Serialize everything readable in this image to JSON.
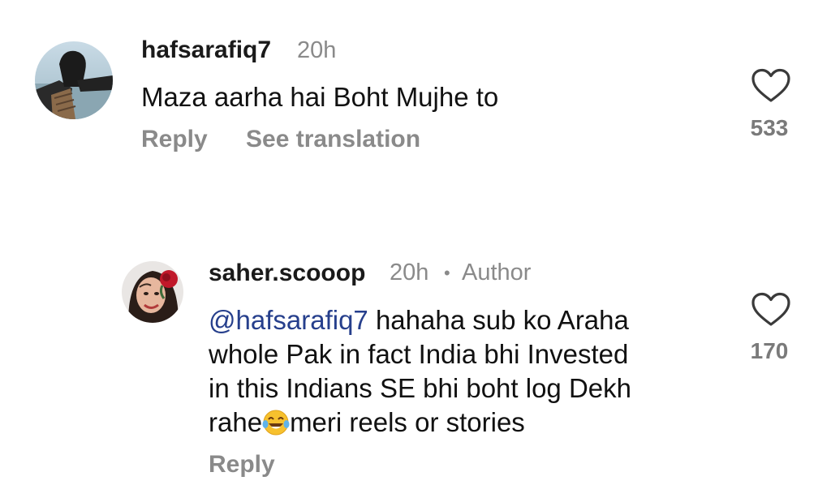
{
  "comments": [
    {
      "username": "hafsarafiq7",
      "time": "20h",
      "text": "Maza aarha hai Boht Mujhe to",
      "actions": {
        "reply": "Reply",
        "translate": "See translation"
      },
      "likes": "533",
      "avatar_icon": "profile-photo"
    },
    {
      "username": "saher.scooop",
      "time": "20h",
      "separator": "•",
      "badge": "Author",
      "mention": "@hafsarafiq7",
      "text_line1": " hahaha sub ko Araha",
      "text_line2": "whole Pak in fact India bhi Invested",
      "text_line3": "in this Indians SE bhi boht log Dekh",
      "text_line4_before": "rahe",
      "emoji": "😂",
      "text_line4_after": "meri reels or stories",
      "actions": {
        "reply": "Reply"
      },
      "likes": "170",
      "avatar_icon": "profile-photo"
    }
  ],
  "icons": {
    "like": "heart-outline-icon",
    "emoji": "face-with-tears-of-joy"
  },
  "colors": {
    "mention": "#263f8c",
    "muted": "#8a8a8a"
  }
}
